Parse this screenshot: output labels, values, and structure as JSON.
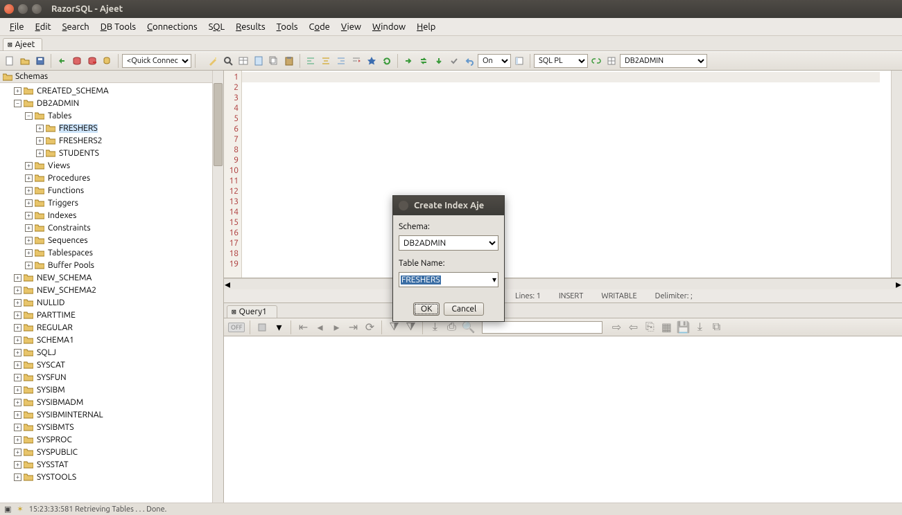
{
  "title": "RazorSQL - Ajeet",
  "menu": [
    "File",
    "Edit",
    "Search",
    "DB Tools",
    "Connections",
    "SQL",
    "Results",
    "Tools",
    "Code",
    "View",
    "Window",
    "Help"
  ],
  "tabs": {
    "main": "Ajeet"
  },
  "toolbar": {
    "quick_connect": "<Quick Connect>",
    "on": "On",
    "lang": "SQL PL",
    "db": "DB2ADMIN"
  },
  "tree": {
    "root": "Schemas",
    "created_schema": "CREATED_SCHEMA",
    "db2admin": "DB2ADMIN",
    "tables": "Tables",
    "freshers": "FRESHERS",
    "freshers2": "FRESHERS2",
    "students": "STUDENTS",
    "views": "Views",
    "procedures": "Procedures",
    "functions": "Functions",
    "triggers": "Triggers",
    "indexes": "Indexes",
    "constraints": "Constraints",
    "sequences": "Sequences",
    "tablespaces": "Tablespaces",
    "bufferpools": "Buffer Pools",
    "schemas": [
      "NEW_SCHEMA",
      "NEW_SCHEMA2",
      "NULLID",
      "PARTTIME",
      "REGULAR",
      "SCHEMA1",
      "SQLJ",
      "SYSCAT",
      "SYSFUN",
      "SYSIBM",
      "SYSIBMADM",
      "SYSIBMINTERNAL",
      "SYSIBMTS",
      "SYSPROC",
      "SYSPUBLIC",
      "SYSSTAT",
      "SYSTOOLS"
    ]
  },
  "editor": {
    "status_lines": "Lines: 1",
    "status_insert": "INSERT",
    "status_write": "WRITABLE",
    "status_delim": "Delimiter: ;"
  },
  "query_tab": "Query1",
  "results_off": "OFF",
  "dialog": {
    "title": "Create Index Aje",
    "schema_label": "Schema:",
    "schema_value": "DB2ADMIN",
    "table_label": "Table Name:",
    "table_value": "FRESHERS",
    "ok": "OK",
    "cancel": "Cancel"
  },
  "statusbar": "15:23:33:581 Retrieving Tables . . . Done."
}
